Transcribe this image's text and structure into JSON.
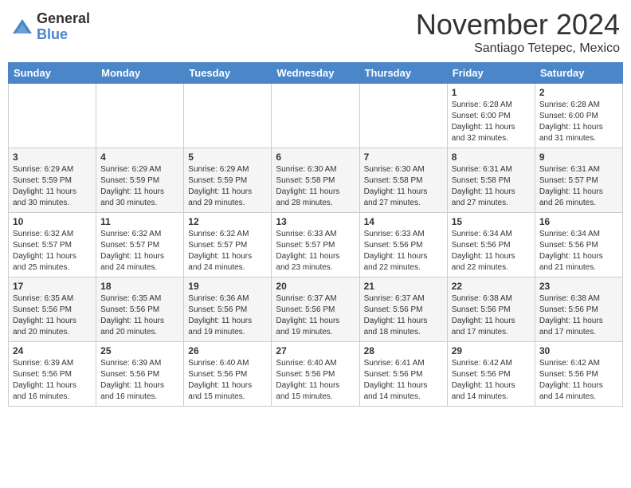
{
  "logo": {
    "general": "General",
    "blue": "Blue"
  },
  "title": "November 2024",
  "location": "Santiago Tetepec, Mexico",
  "weekdays": [
    "Sunday",
    "Monday",
    "Tuesday",
    "Wednesday",
    "Thursday",
    "Friday",
    "Saturday"
  ],
  "weeks": [
    [
      {
        "day": "",
        "info": ""
      },
      {
        "day": "",
        "info": ""
      },
      {
        "day": "",
        "info": ""
      },
      {
        "day": "",
        "info": ""
      },
      {
        "day": "",
        "info": ""
      },
      {
        "day": "1",
        "info": "Sunrise: 6:28 AM\nSunset: 6:00 PM\nDaylight: 11 hours and 32 minutes."
      },
      {
        "day": "2",
        "info": "Sunrise: 6:28 AM\nSunset: 6:00 PM\nDaylight: 11 hours and 31 minutes."
      }
    ],
    [
      {
        "day": "3",
        "info": "Sunrise: 6:29 AM\nSunset: 5:59 PM\nDaylight: 11 hours and 30 minutes."
      },
      {
        "day": "4",
        "info": "Sunrise: 6:29 AM\nSunset: 5:59 PM\nDaylight: 11 hours and 30 minutes."
      },
      {
        "day": "5",
        "info": "Sunrise: 6:29 AM\nSunset: 5:59 PM\nDaylight: 11 hours and 29 minutes."
      },
      {
        "day": "6",
        "info": "Sunrise: 6:30 AM\nSunset: 5:58 PM\nDaylight: 11 hours and 28 minutes."
      },
      {
        "day": "7",
        "info": "Sunrise: 6:30 AM\nSunset: 5:58 PM\nDaylight: 11 hours and 27 minutes."
      },
      {
        "day": "8",
        "info": "Sunrise: 6:31 AM\nSunset: 5:58 PM\nDaylight: 11 hours and 27 minutes."
      },
      {
        "day": "9",
        "info": "Sunrise: 6:31 AM\nSunset: 5:57 PM\nDaylight: 11 hours and 26 minutes."
      }
    ],
    [
      {
        "day": "10",
        "info": "Sunrise: 6:32 AM\nSunset: 5:57 PM\nDaylight: 11 hours and 25 minutes."
      },
      {
        "day": "11",
        "info": "Sunrise: 6:32 AM\nSunset: 5:57 PM\nDaylight: 11 hours and 24 minutes."
      },
      {
        "day": "12",
        "info": "Sunrise: 6:32 AM\nSunset: 5:57 PM\nDaylight: 11 hours and 24 minutes."
      },
      {
        "day": "13",
        "info": "Sunrise: 6:33 AM\nSunset: 5:57 PM\nDaylight: 11 hours and 23 minutes."
      },
      {
        "day": "14",
        "info": "Sunrise: 6:33 AM\nSunset: 5:56 PM\nDaylight: 11 hours and 22 minutes."
      },
      {
        "day": "15",
        "info": "Sunrise: 6:34 AM\nSunset: 5:56 PM\nDaylight: 11 hours and 22 minutes."
      },
      {
        "day": "16",
        "info": "Sunrise: 6:34 AM\nSunset: 5:56 PM\nDaylight: 11 hours and 21 minutes."
      }
    ],
    [
      {
        "day": "17",
        "info": "Sunrise: 6:35 AM\nSunset: 5:56 PM\nDaylight: 11 hours and 20 minutes."
      },
      {
        "day": "18",
        "info": "Sunrise: 6:35 AM\nSunset: 5:56 PM\nDaylight: 11 hours and 20 minutes."
      },
      {
        "day": "19",
        "info": "Sunrise: 6:36 AM\nSunset: 5:56 PM\nDaylight: 11 hours and 19 minutes."
      },
      {
        "day": "20",
        "info": "Sunrise: 6:37 AM\nSunset: 5:56 PM\nDaylight: 11 hours and 19 minutes."
      },
      {
        "day": "21",
        "info": "Sunrise: 6:37 AM\nSunset: 5:56 PM\nDaylight: 11 hours and 18 minutes."
      },
      {
        "day": "22",
        "info": "Sunrise: 6:38 AM\nSunset: 5:56 PM\nDaylight: 11 hours and 17 minutes."
      },
      {
        "day": "23",
        "info": "Sunrise: 6:38 AM\nSunset: 5:56 PM\nDaylight: 11 hours and 17 minutes."
      }
    ],
    [
      {
        "day": "24",
        "info": "Sunrise: 6:39 AM\nSunset: 5:56 PM\nDaylight: 11 hours and 16 minutes."
      },
      {
        "day": "25",
        "info": "Sunrise: 6:39 AM\nSunset: 5:56 PM\nDaylight: 11 hours and 16 minutes."
      },
      {
        "day": "26",
        "info": "Sunrise: 6:40 AM\nSunset: 5:56 PM\nDaylight: 11 hours and 15 minutes."
      },
      {
        "day": "27",
        "info": "Sunrise: 6:40 AM\nSunset: 5:56 PM\nDaylight: 11 hours and 15 minutes."
      },
      {
        "day": "28",
        "info": "Sunrise: 6:41 AM\nSunset: 5:56 PM\nDaylight: 11 hours and 14 minutes."
      },
      {
        "day": "29",
        "info": "Sunrise: 6:42 AM\nSunset: 5:56 PM\nDaylight: 11 hours and 14 minutes."
      },
      {
        "day": "30",
        "info": "Sunrise: 6:42 AM\nSunset: 5:56 PM\nDaylight: 11 hours and 14 minutes."
      }
    ]
  ]
}
